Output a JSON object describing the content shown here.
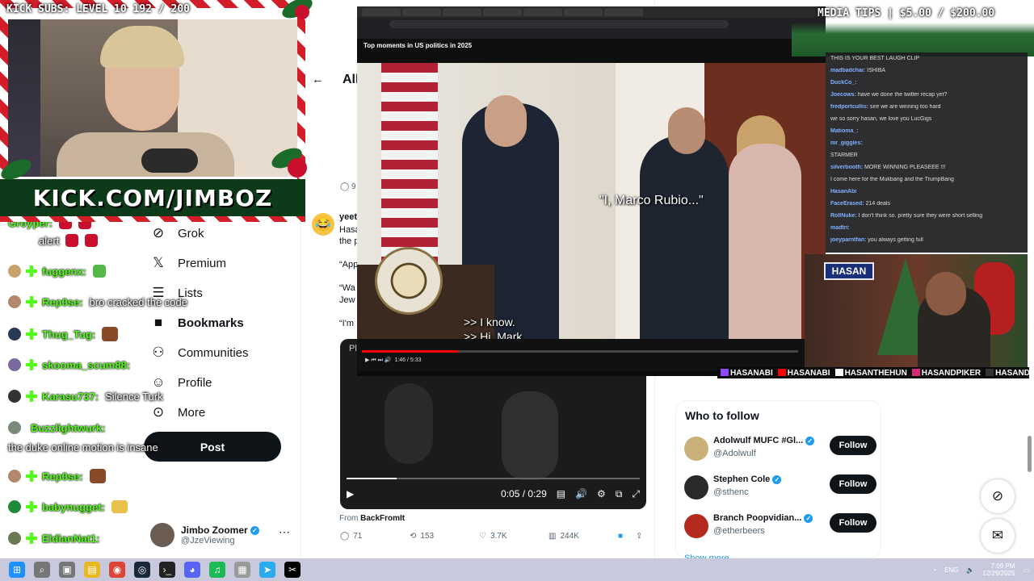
{
  "overlay": {
    "kick_subs": "KICK SUBS: LEVEL 10 192 / 200",
    "kick_url": "KICK.COM/JIMBOZ",
    "media_tips": "MEDIA TIPS | $5.00 / $200.00",
    "hasan_logo": "HASAN",
    "socials": [
      "HASANABI",
      "HASANABI",
      "HASANTHEHUN",
      "HASANDPIKER",
      "HASANDPIKER"
    ]
  },
  "left_chat": [
    {
      "user": "Groyper:",
      "msg": "",
      "badge_color": "#9b4dca"
    },
    {
      "user": "",
      "msg": "alert",
      "badge_color": "#ffffff"
    },
    {
      "user": "fuggenx:",
      "msg": "",
      "badge_color": "#c9a26b"
    },
    {
      "user": "Rep0se:",
      "msg": "bro cracked the code",
      "badge_color": "#b5876a"
    },
    {
      "user": "Thug_Tug:",
      "msg": "",
      "badge_color": "#2a3a55"
    },
    {
      "user": "skooma_scum88:",
      "msg": "",
      "badge_color": "#7a6aa0"
    },
    {
      "user": "Karasu737:",
      "msg": "Silence Turk",
      "badge_color": "#333333"
    },
    {
      "user": "Buzzlightwurk:",
      "msg": "",
      "badge_color": "#7a8a7a"
    },
    {
      "user": "",
      "msg": "the duke online motion is insane",
      "badge_color": ""
    },
    {
      "user": "Rep0se:",
      "msg": "",
      "badge_color": "#b5876a"
    },
    {
      "user": "babynugget:",
      "msg": "",
      "badge_color": "#1f8a3a"
    },
    {
      "user": "EldianNat1:",
      "msg": "",
      "badge_color": "#6b7a55"
    }
  ],
  "x_nav": {
    "items": [
      {
        "label": "Grok",
        "icon": "grok-icon",
        "glyph": "⊘"
      },
      {
        "label": "Premium",
        "icon": "x-logo-icon",
        "glyph": "𝕏"
      },
      {
        "label": "Lists",
        "icon": "lists-icon",
        "glyph": "☰"
      },
      {
        "label": "Bookmarks",
        "icon": "bookmark-icon",
        "glyph": "🔖"
      },
      {
        "label": "Communities",
        "icon": "communities-icon",
        "glyph": "👥"
      },
      {
        "label": "Profile",
        "icon": "profile-icon",
        "glyph": "👤"
      },
      {
        "label": "More",
        "icon": "more-icon",
        "glyph": "⋯"
      }
    ],
    "post_label": "Post",
    "account_name": "Jimbo Zoomer",
    "account_handle": "@JzeViewing"
  },
  "feed": {
    "title": "All",
    "reply_count_top": "9",
    "author": "yeet",
    "lines": [
      "Hasa",
      "the p",
      "“App",
      "“Wa",
      "Jew",
      "“I'm"
    ],
    "video_label": "Pl",
    "video_time": "0:05 / 0:29",
    "video_progress": 0.17,
    "from_label": "From",
    "from_source": "BackFromIt",
    "replies": "71",
    "reposts": "153",
    "likes": "3.7K",
    "views": "244K"
  },
  "who_to_follow": {
    "title": "Who to follow",
    "users": [
      {
        "name": "Adolwulf MUFC #Gl...",
        "handle": "@Adolwulf",
        "button": "Follow",
        "avatar_color": "#c9b27a"
      },
      {
        "name": "Stephen Cole",
        "handle": "@sthenc",
        "button": "Follow",
        "avatar_color": "#2a2a2a"
      },
      {
        "name": "Branch Poopvidian...",
        "handle": "@etherbeers",
        "button": "Follow",
        "avatar_color": "#b52a1f"
      }
    ],
    "show_more": "Show more"
  },
  "screen_share": {
    "page_title": "Top moments in US politics in 2025",
    "caption_quote": "\"I, Marco Rubio...\"",
    "caption_line1": ">> I know.",
    "caption_line2": ">> Hi, Mark.",
    "player_time": "1:46 / 5:33",
    "player_progress": 0.22
  },
  "right_chat": [
    {
      "user": "",
      "msg": "THIS IS YOUR BEST LAUGH CLIP"
    },
    {
      "user": "madbadchai:",
      "msg": "ISHIBA"
    },
    {
      "user": "DuckCo_:",
      "msg": ""
    },
    {
      "user": "Joecows:",
      "msg": "have we done the twitter recap yet?"
    },
    {
      "user": "fredportcullis:",
      "msg": "sire we are winning too hard"
    },
    {
      "user": "",
      "msg": "we so sorry hasan, we love you LucGigs"
    },
    {
      "user": "Matioma_:",
      "msg": ""
    },
    {
      "user": "mr_giggles:",
      "msg": ""
    },
    {
      "user": "",
      "msg": "STARMER"
    },
    {
      "user": "silverbooth:",
      "msg": "MORE WINNING PLEASEEE !!!"
    },
    {
      "user": "",
      "msg": "I come here for the Mukbang and the TrumpBang"
    },
    {
      "user": "HasanAbi",
      "msg": ""
    },
    {
      "user": "FaceErased:",
      "msg": "214 deals"
    },
    {
      "user": "RollNuke:",
      "msg": "I don't think so. pretty sure they were short selling"
    },
    {
      "user": "madtri:",
      "msg": ""
    },
    {
      "user": "joeyparntfan:",
      "msg": "you always getting full"
    }
  ],
  "taskbar": {
    "icons": [
      "start-icon",
      "search-icon",
      "task-view-icon",
      "file-explorer-icon",
      "chrome-icon",
      "steam-icon",
      "terminal-icon",
      "discord-icon",
      "spotify-icon",
      "app-icon",
      "telegram-icon",
      "capcut-icon"
    ],
    "lang": "ENG",
    "time": "7:09 PM",
    "date": "12/29/2025"
  },
  "colors": {
    "kick_green": "#53fc18",
    "x_blue": "#1d9bf0",
    "candy_red": "#d31e2a",
    "youtube_red": "#ff0000"
  }
}
